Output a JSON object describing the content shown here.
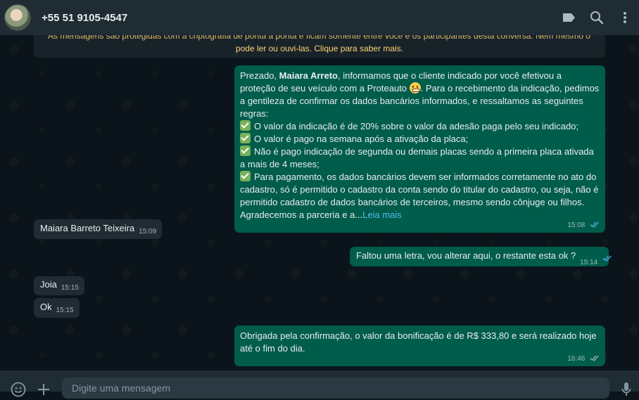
{
  "header": {
    "contact_name": "+55 51 9105-4547",
    "icons": [
      "avatar",
      "label-icon",
      "search-icon",
      "menu-icon"
    ]
  },
  "encryption_notice": {
    "line1": "As mensagens são protegidas com a criptografia de ponta a ponta e ficam somente entre você e os participantes desta conversa. Nem mesmo o WhatsApp",
    "line2": "pode ler ou ouvi-las. Clique para saber mais."
  },
  "messages": [
    {
      "direction": "outgoing",
      "intro_before": "Prezado, ",
      "intro_name": "Maiara Arreto",
      "intro_after": ", informamos que o cliente indicado por você efetivou a proteção de seu veículo com a Proteauto ",
      "intro_end": ". Para o recebimento da indicação, pedimos a gentileza de confirmar os dados bancários informados, e ressaltamos as seguintes regras:",
      "rules": [
        "O valor da indicação é de 20% sobre o valor da adesão paga pelo seu indicado;",
        "O valor é pago na semana após a ativação da placa;",
        "Não é pago indicação de segunda ou demais placas sendo a primeira placa ativada a mais de 4 meses;",
        "Para pagamento, os dados bancários devem ser informados corretamente no ato do cadastro, só é permitido o cadastro da conta sendo do titular do cadastro, ou seja, não é permitido cadastro de dados bancários de terceiros, mesmo sendo cônjuge ou filhos."
      ],
      "closing": "Agradecemos a parceria e a...",
      "read_more": "Leia mais",
      "time": "15:08",
      "status": "read"
    },
    {
      "direction": "incoming",
      "text": "Maiara Barreto Teixeira",
      "time": "15:09"
    },
    {
      "direction": "outgoing",
      "text": "Faltou uma letra, vou alterar aqui, o restante esta ok ?",
      "time": "15:14",
      "status": "read"
    },
    {
      "direction": "incoming",
      "text": "Joia",
      "time": "15:15"
    },
    {
      "direction": "incoming",
      "text": "Ok",
      "time": "15:15"
    },
    {
      "direction": "outgoing",
      "text": "Obrigada pela confirmação, o valor da bonificação é de R$ 333,80 e será realizado hoje até o fim do dia.",
      "time": "16:46",
      "status": "delivered"
    }
  ],
  "composer": {
    "placeholder": "Digite uma mensagem",
    "icons": [
      "emoji-icon",
      "attach-plus-icon",
      "microphone-icon"
    ]
  },
  "colors": {
    "header_bg": "#202c33",
    "chat_bg": "#0b141a",
    "outgoing_bubble": "#005c4b",
    "incoming_bubble": "#202c33",
    "read_tick": "#53bdeb",
    "encryption_text": "#ffd279"
  }
}
